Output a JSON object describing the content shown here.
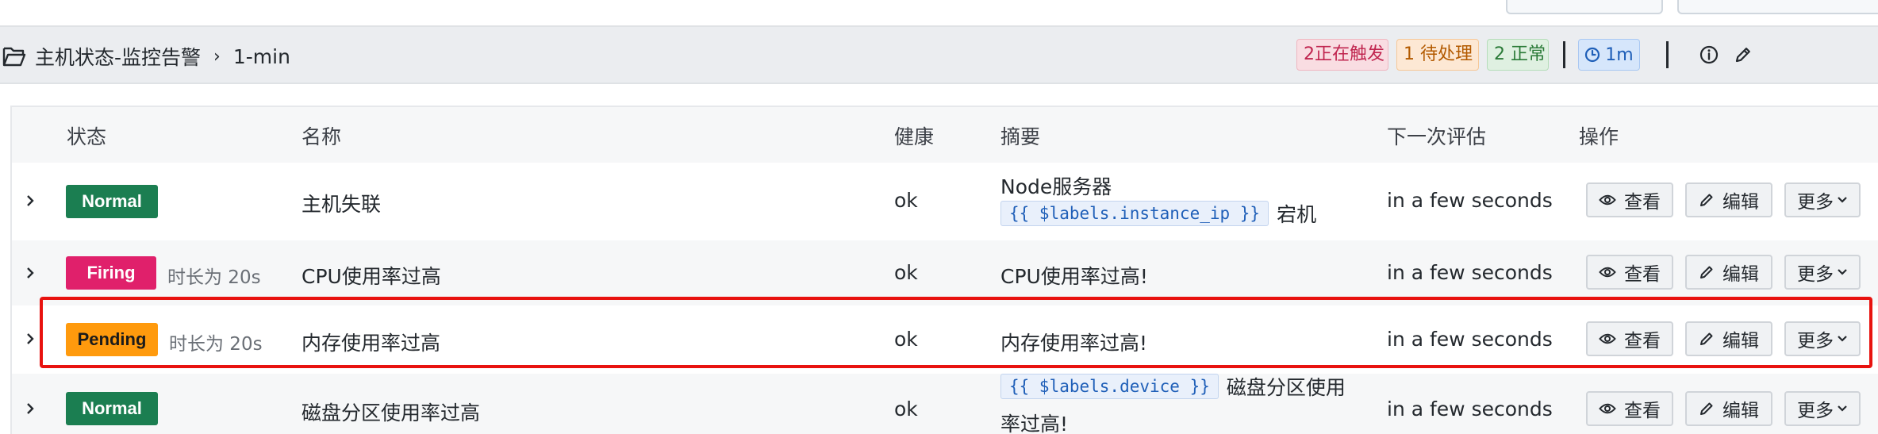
{
  "group": {
    "path": [
      "主机状态-监控告警",
      "1-min"
    ],
    "badges": {
      "firing": "2正在触发",
      "pending": "1 待处理",
      "normal": "2 正常",
      "interval": "1m"
    }
  },
  "table": {
    "columns": [
      "状态",
      "名称",
      "健康",
      "摘要",
      "下一次评估",
      "操作"
    ],
    "rows": [
      {
        "state": "Normal",
        "duration": "",
        "name": "主机失联",
        "health": "ok",
        "summary_line1_text": "Node服务器",
        "summary_code": "{{ $labels.instance_ip }}",
        "summary_after_code": "宕机",
        "next_eval": "in a few seconds"
      },
      {
        "state": "Firing",
        "duration": "时长为 20s",
        "name": "CPU使用率过高",
        "health": "ok",
        "summary": "CPU使用率过高!",
        "next_eval": "in a few seconds"
      },
      {
        "state": "Pending",
        "duration": "时长为 20s",
        "name": "内存使用率过高",
        "health": "ok",
        "summary": "内存使用率过高!",
        "next_eval": "in a few seconds"
      },
      {
        "state": "Normal",
        "duration": "",
        "name": "磁盘分区使用率过高",
        "health": "ok",
        "summary_code": "{{ $labels.device }}",
        "summary_after_code": "磁盘分区使用",
        "summary_line2_text": "率过高!",
        "next_eval": "in a few seconds"
      }
    ]
  },
  "actions": {
    "view": "查看",
    "edit": "编辑",
    "more": "更多"
  },
  "colors": {
    "normal": "#1b7e51",
    "firing": "#e0206b",
    "pending": "#ff9a0d",
    "highlight": "#e8120f"
  }
}
